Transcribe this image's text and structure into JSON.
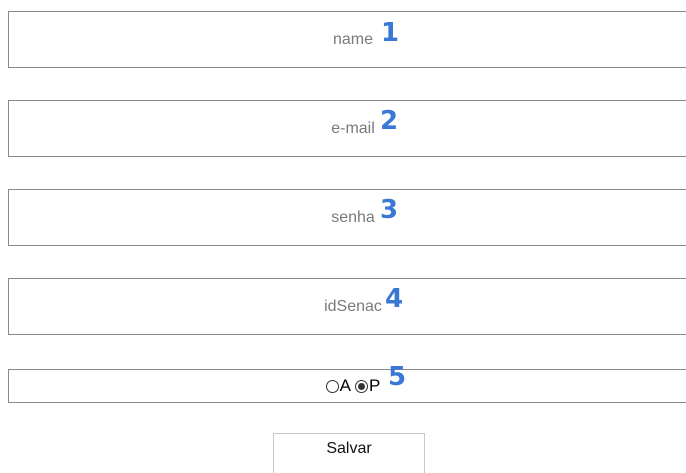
{
  "form": {
    "name": {
      "value": "",
      "placeholder": "name",
      "annotation": "1"
    },
    "email": {
      "value": "",
      "placeholder": "e-mail",
      "annotation": "2"
    },
    "senha": {
      "value": "",
      "placeholder": "senha",
      "annotation": "3"
    },
    "id_senac": {
      "value": "",
      "placeholder": "idSenac",
      "annotation": "4"
    },
    "tipo": {
      "annotation": "5",
      "selected": "P",
      "options": [
        {
          "label": "A",
          "checked": false
        },
        {
          "label": "P",
          "checked": true
        }
      ]
    },
    "save_label": "Salvar"
  },
  "colors": {
    "annotation": "#3a78d6",
    "border": "#8a8a8a"
  }
}
